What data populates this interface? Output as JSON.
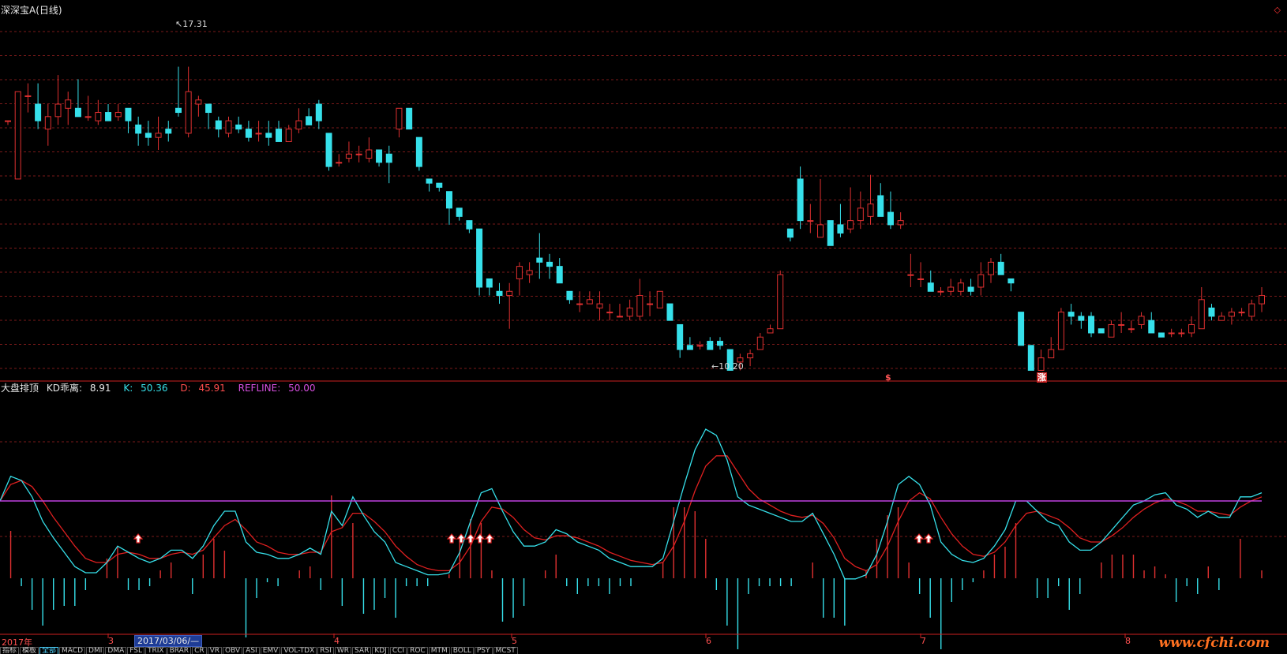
{
  "chart_title": "深深宝A(日线)",
  "price_annotations": {
    "high": "17.31",
    "low": "10.20"
  },
  "indicator": {
    "name": "大盘排顶",
    "kd_label": "KD乖离:",
    "kd_value": "8.91",
    "k_label": "K:",
    "k_value": "50.36",
    "d_label": "D:",
    "d_value": "45.91",
    "ref_label": "REFLINE:",
    "ref_value": "50.00"
  },
  "signals": {
    "s_marker": "$",
    "zhang_marker": "涨"
  },
  "x_axis": {
    "year": "2017年",
    "months": [
      "3",
      "4",
      "5",
      "6",
      "7",
      "8"
    ],
    "selected_date": "2017/03/06/—"
  },
  "tabs": [
    "指标",
    "模板",
    "全部",
    "MACD",
    "DMI",
    "DMA",
    "FSL",
    "TRIX",
    "BRAR",
    "CR",
    "VR",
    "OBV",
    "ASI",
    "EMV",
    "VOL-TDX",
    "RSI",
    "WR",
    "SAR",
    "KDJ",
    "CCI",
    "ROC",
    "MTM",
    "BOLL",
    "PSY",
    "MCST"
  ],
  "active_tab": "全部",
  "watermark": "www.cfchi.com",
  "corner_icon": "◇",
  "colors": {
    "up": "#e03030",
    "down": "#36e0ea",
    "k_line": "#36e0ea",
    "d_line": "#e02020",
    "refline": "#c040e0",
    "grid": "#7a1a1a"
  },
  "chart_data": {
    "type": "candlestick",
    "title": "深深宝A(日线)",
    "price_range": [
      9.8,
      18.6
    ],
    "candles": [
      [
        16.0,
        16.0,
        15.9,
        16.0
      ],
      [
        14.6,
        16.7,
        14.6,
        16.7
      ],
      [
        16.6,
        16.9,
        16.2,
        16.6
      ],
      [
        16.4,
        16.9,
        15.8,
        16.0
      ],
      [
        15.8,
        16.4,
        15.4,
        16.1
      ],
      [
        16.1,
        17.1,
        15.9,
        16.4
      ],
      [
        16.3,
        16.7,
        15.9,
        16.5
      ],
      [
        16.3,
        17.0,
        16.2,
        16.1
      ],
      [
        16.1,
        16.6,
        16.0,
        16.1
      ],
      [
        16.0,
        16.5,
        15.9,
        16.2
      ],
      [
        16.2,
        16.4,
        16.0,
        16.0
      ],
      [
        16.1,
        16.4,
        16.0,
        16.2
      ],
      [
        16.3,
        16.3,
        15.7,
        16.0
      ],
      [
        15.9,
        16.1,
        15.4,
        15.7
      ],
      [
        15.7,
        16.0,
        15.4,
        15.6
      ],
      [
        15.6,
        16.1,
        15.3,
        15.7
      ],
      [
        15.8,
        16.0,
        15.5,
        15.7
      ],
      [
        16.3,
        17.3,
        16.1,
        16.2
      ],
      [
        15.7,
        17.3,
        15.6,
        16.7
      ],
      [
        16.4,
        16.6,
        16.1,
        16.5
      ],
      [
        16.4,
        16.4,
        15.8,
        16.2
      ],
      [
        16.0,
        16.1,
        15.6,
        15.8
      ],
      [
        15.7,
        16.1,
        15.6,
        16.0
      ],
      [
        15.9,
        16.1,
        15.7,
        15.8
      ],
      [
        15.8,
        16.0,
        15.5,
        15.6
      ],
      [
        15.7,
        16.0,
        15.5,
        15.7
      ],
      [
        15.7,
        16.0,
        15.4,
        15.6
      ],
      [
        15.8,
        16.0,
        15.5,
        15.5
      ],
      [
        15.5,
        15.9,
        15.5,
        15.8
      ],
      [
        15.8,
        16.3,
        15.7,
        16.0
      ],
      [
        16.1,
        16.3,
        16.0,
        15.9
      ],
      [
        16.4,
        16.5,
        15.8,
        16.0
      ],
      [
        15.7,
        15.7,
        14.8,
        14.9
      ],
      [
        15.0,
        15.2,
        14.9,
        15.0
      ],
      [
        15.1,
        15.5,
        15.0,
        15.2
      ],
      [
        15.2,
        15.4,
        15.0,
        15.2
      ],
      [
        15.1,
        15.6,
        15.0,
        15.3
      ],
      [
        15.3,
        15.3,
        14.9,
        15.0
      ],
      [
        15.2,
        15.4,
        14.5,
        15.0
      ],
      [
        15.8,
        16.3,
        15.6,
        16.3
      ],
      [
        16.3,
        16.3,
        15.8,
        15.8
      ],
      [
        15.6,
        15.6,
        14.8,
        14.9
      ],
      [
        14.6,
        14.6,
        14.3,
        14.5
      ],
      [
        14.5,
        14.5,
        14.3,
        14.4
      ],
      [
        14.3,
        14.3,
        13.5,
        13.9
      ],
      [
        13.9,
        13.9,
        13.6,
        13.7
      ],
      [
        13.6,
        13.6,
        13.3,
        13.4
      ],
      [
        13.4,
        13.4,
        11.8,
        12.0
      ],
      [
        12.2,
        12.2,
        11.8,
        12.0
      ],
      [
        11.9,
        12.1,
        11.6,
        11.8
      ],
      [
        11.8,
        12.1,
        11.0,
        11.9
      ],
      [
        12.2,
        12.6,
        11.8,
        12.5
      ],
      [
        12.3,
        12.6,
        12.1,
        12.4
      ],
      [
        12.7,
        13.3,
        12.2,
        12.6
      ],
      [
        12.6,
        12.8,
        12.2,
        12.5
      ],
      [
        12.5,
        12.7,
        12.3,
        12.1
      ],
      [
        11.9,
        11.9,
        11.6,
        11.7
      ],
      [
        11.6,
        11.9,
        11.4,
        11.6
      ],
      [
        11.6,
        11.9,
        11.6,
        11.7
      ],
      [
        11.5,
        11.9,
        11.2,
        11.6
      ],
      [
        11.4,
        11.6,
        11.2,
        11.4
      ],
      [
        11.3,
        11.6,
        11.3,
        11.3
      ],
      [
        11.3,
        11.7,
        11.2,
        11.5
      ],
      [
        11.3,
        12.2,
        11.2,
        11.8
      ],
      [
        11.6,
        11.9,
        11.3,
        11.6
      ],
      [
        11.5,
        11.9,
        11.5,
        11.9
      ],
      [
        11.6,
        11.6,
        11.2,
        11.2
      ],
      [
        11.1,
        11.1,
        10.3,
        10.5
      ],
      [
        10.6,
        10.8,
        10.5,
        10.5
      ],
      [
        10.6,
        10.7,
        10.5,
        10.6
      ],
      [
        10.7,
        10.8,
        10.6,
        10.5
      ],
      [
        10.7,
        10.8,
        10.5,
        10.6
      ],
      [
        10.5,
        10.5,
        10.0,
        10.0
      ],
      [
        10.2,
        10.4,
        10.0,
        10.3
      ],
      [
        10.3,
        10.5,
        10.1,
        10.4
      ],
      [
        10.5,
        10.9,
        10.5,
        10.8
      ],
      [
        10.9,
        11.1,
        10.9,
        11.0
      ],
      [
        11.0,
        12.4,
        11.0,
        12.3
      ],
      [
        13.4,
        13.4,
        13.1,
        13.2
      ],
      [
        14.6,
        14.9,
        13.4,
        13.6
      ],
      [
        13.6,
        14.0,
        13.3,
        13.6
      ],
      [
        13.2,
        14.6,
        13.2,
        13.5
      ],
      [
        13.6,
        13.6,
        13.1,
        13.0
      ],
      [
        13.5,
        14.0,
        13.2,
        13.3
      ],
      [
        13.4,
        14.4,
        13.3,
        13.6
      ],
      [
        13.6,
        14.3,
        13.4,
        13.9
      ],
      [
        13.7,
        14.7,
        13.5,
        14.0
      ],
      [
        14.2,
        14.5,
        13.7,
        13.7
      ],
      [
        13.8,
        14.3,
        13.4,
        13.5
      ],
      [
        13.5,
        13.8,
        13.4,
        13.6
      ],
      [
        12.3,
        12.8,
        12.0,
        12.3
      ],
      [
        12.2,
        12.6,
        12.0,
        12.2
      ],
      [
        12.1,
        12.4,
        11.9,
        11.9
      ],
      [
        11.9,
        12.0,
        11.8,
        11.9
      ],
      [
        11.9,
        12.2,
        11.8,
        12.0
      ],
      [
        11.9,
        12.2,
        11.8,
        12.1
      ],
      [
        12.0,
        12.2,
        11.8,
        11.9
      ],
      [
        12.0,
        12.6,
        11.8,
        12.3
      ],
      [
        12.3,
        12.7,
        12.1,
        12.6
      ],
      [
        12.6,
        12.8,
        12.5,
        12.3
      ],
      [
        12.2,
        12.2,
        11.9,
        12.1
      ],
      [
        11.4,
        11.4,
        10.6,
        10.6
      ],
      [
        10.6,
        10.6,
        10.0,
        10.0
      ],
      [
        10.0,
        10.5,
        10.0,
        10.3
      ],
      [
        10.3,
        10.8,
        10.3,
        10.5
      ],
      [
        10.5,
        11.5,
        10.5,
        11.4
      ],
      [
        11.4,
        11.6,
        11.1,
        11.3
      ],
      [
        11.3,
        11.4,
        11.0,
        11.2
      ],
      [
        11.3,
        11.4,
        10.8,
        10.9
      ],
      [
        11.0,
        11.0,
        10.9,
        10.9
      ],
      [
        10.8,
        11.2,
        10.8,
        11.1
      ],
      [
        11.1,
        11.4,
        10.9,
        11.1
      ],
      [
        11.0,
        11.2,
        10.9,
        11.0
      ],
      [
        11.1,
        11.4,
        11.0,
        11.3
      ],
      [
        11.2,
        11.4,
        10.9,
        10.9
      ],
      [
        10.9,
        10.9,
        10.8,
        10.8
      ],
      [
        10.9,
        11.0,
        10.8,
        10.9
      ],
      [
        10.9,
        11.0,
        10.8,
        10.9
      ],
      [
        10.9,
        11.3,
        10.8,
        11.1
      ],
      [
        11.0,
        12.0,
        11.0,
        11.7
      ],
      [
        11.5,
        11.6,
        11.2,
        11.3
      ],
      [
        11.2,
        11.4,
        11.2,
        11.3
      ],
      [
        11.3,
        11.5,
        11.1,
        11.4
      ],
      [
        11.4,
        11.5,
        11.3,
        11.4
      ],
      [
        11.3,
        11.7,
        11.2,
        11.6
      ],
      [
        11.6,
        12.0,
        11.4,
        11.8
      ]
    ],
    "k_series": [
      50,
      62,
      60,
      52,
      40,
      32,
      25,
      18,
      15,
      15,
      20,
      28,
      25,
      22,
      20,
      22,
      26,
      26,
      22,
      28,
      38,
      45,
      45,
      30,
      25,
      24,
      22,
      22,
      24,
      27,
      24,
      45,
      38,
      52,
      43,
      35,
      30,
      20,
      18,
      16,
      14,
      14,
      15,
      25,
      40,
      54,
      56,
      45,
      35,
      28,
      28,
      30,
      36,
      34,
      30,
      28,
      26,
      22,
      20,
      18,
      18,
      18,
      22,
      40,
      58,
      75,
      85,
      82,
      70,
      52,
      48,
      46,
      44,
      42,
      40,
      40,
      44,
      34,
      24,
      12,
      12,
      14,
      24,
      40,
      58,
      62,
      58,
      48,
      30,
      24,
      21,
      20,
      22,
      28,
      36,
      50,
      50,
      45,
      40,
      38,
      30,
      26,
      26,
      30,
      36,
      42,
      48,
      50,
      53,
      54,
      48,
      46,
      42,
      45,
      42,
      42,
      52,
      52,
      54
    ],
    "d_series": [
      50,
      58,
      60,
      57,
      50,
      42,
      35,
      28,
      22,
      20,
      20,
      24,
      25,
      24,
      22,
      22,
      24,
      25,
      24,
      26,
      32,
      38,
      41,
      36,
      30,
      28,
      25,
      24,
      24,
      25,
      25,
      35,
      37,
      44,
      44,
      40,
      35,
      28,
      23,
      19,
      17,
      16,
      16,
      20,
      28,
      40,
      47,
      46,
      42,
      36,
      32,
      31,
      33,
      33,
      32,
      30,
      28,
      25,
      23,
      21,
      20,
      19,
      20,
      28,
      40,
      55,
      67,
      72,
      72,
      64,
      56,
      51,
      48,
      45,
      43,
      42,
      43,
      39,
      32,
      22,
      18,
      16,
      19,
      28,
      40,
      50,
      54,
      51,
      42,
      34,
      28,
      24,
      23,
      25,
      30,
      38,
      44,
      45,
      43,
      41,
      37,
      32,
      30,
      30,
      33,
      37,
      42,
      46,
      49,
      51,
      50,
      48,
      45,
      45,
      44,
      43,
      47,
      50,
      52
    ],
    "refline": 50
  }
}
